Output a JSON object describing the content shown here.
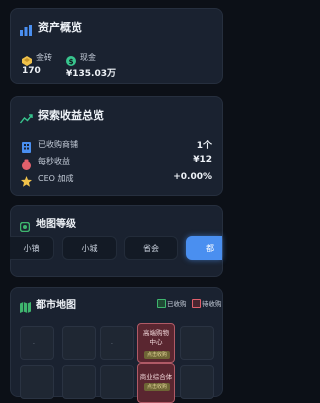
{
  "assets": {
    "title": "资产概览",
    "gold_label": "金砖",
    "gold_value": "170",
    "cash_label": "现金",
    "cash_value": "¥135.03万"
  },
  "earnings": {
    "title": "探索收益总览",
    "rows": [
      {
        "label": "已收购商铺",
        "value": "1个"
      },
      {
        "label": "每秒收益",
        "value": "¥12"
      },
      {
        "label": "CEO 加成",
        "value": "+0.00%"
      }
    ]
  },
  "map_level": {
    "title": "地图等级",
    "options": [
      "小镇",
      "小城",
      "省会",
      "都"
    ],
    "selected_index": 3
  },
  "city_map": {
    "title": "都市地图",
    "legend_owned": "已收购",
    "legend_pending": "待收购",
    "buildings": [
      {
        "name_line1": "高端购物",
        "name_line2": "中心",
        "tag": "点击收购"
      },
      {
        "name_line1": "商业综合体",
        "name_line2": "",
        "tag": "点击收购"
      }
    ]
  },
  "colors": {
    "accent_blue": "#4a8ff0",
    "gold": "#f0c24a",
    "cash_green": "#38c58e",
    "owned_green": "#3fb56e",
    "pending_red": "#e0606c"
  }
}
